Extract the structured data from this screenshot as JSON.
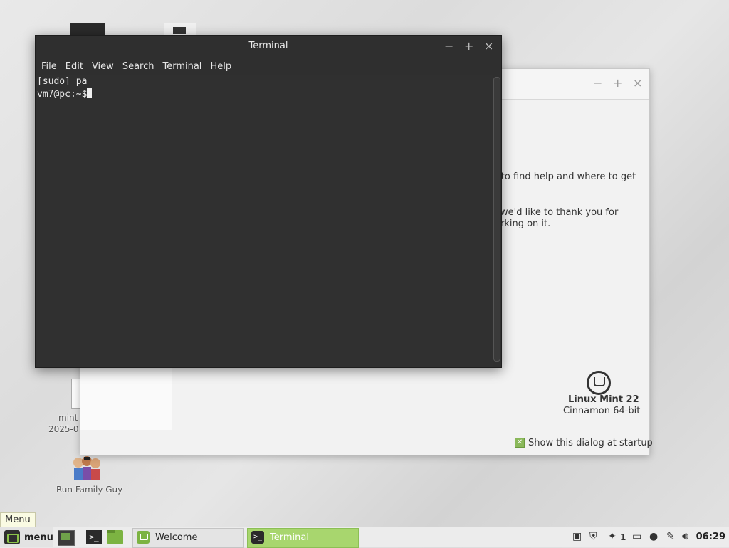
{
  "desktop": {
    "file_label_line1": "mint",
    "file_label_line2": "2025-0",
    "family_guy_label": "Run Family Guy"
  },
  "welcome_window": {
    "text_line1": "w to find help and where to get",
    "text_line2": "we'd like to thank you for",
    "text_line3": "rking on it.",
    "distro_name": "Linux Mint 22",
    "edition": "Cinnamon 64-bit",
    "startup_checkbox_label": "Show this dialog at startup",
    "startup_checked": true
  },
  "terminal": {
    "title": "Terminal",
    "menu": [
      "File",
      "Edit",
      "View",
      "Search",
      "Terminal",
      "Help"
    ],
    "lines": [
      "[sudo] pa",
      "vm7@pc:~$"
    ]
  },
  "panel": {
    "menu_tooltip": "Menu",
    "menu_label": "menu",
    "tasks": [
      {
        "label": "Welcome",
        "active": false
      },
      {
        "label": "Terminal",
        "active": true
      }
    ],
    "tray_count": "1",
    "clock": "06:29",
    "accent_color": "#a8d66e"
  }
}
